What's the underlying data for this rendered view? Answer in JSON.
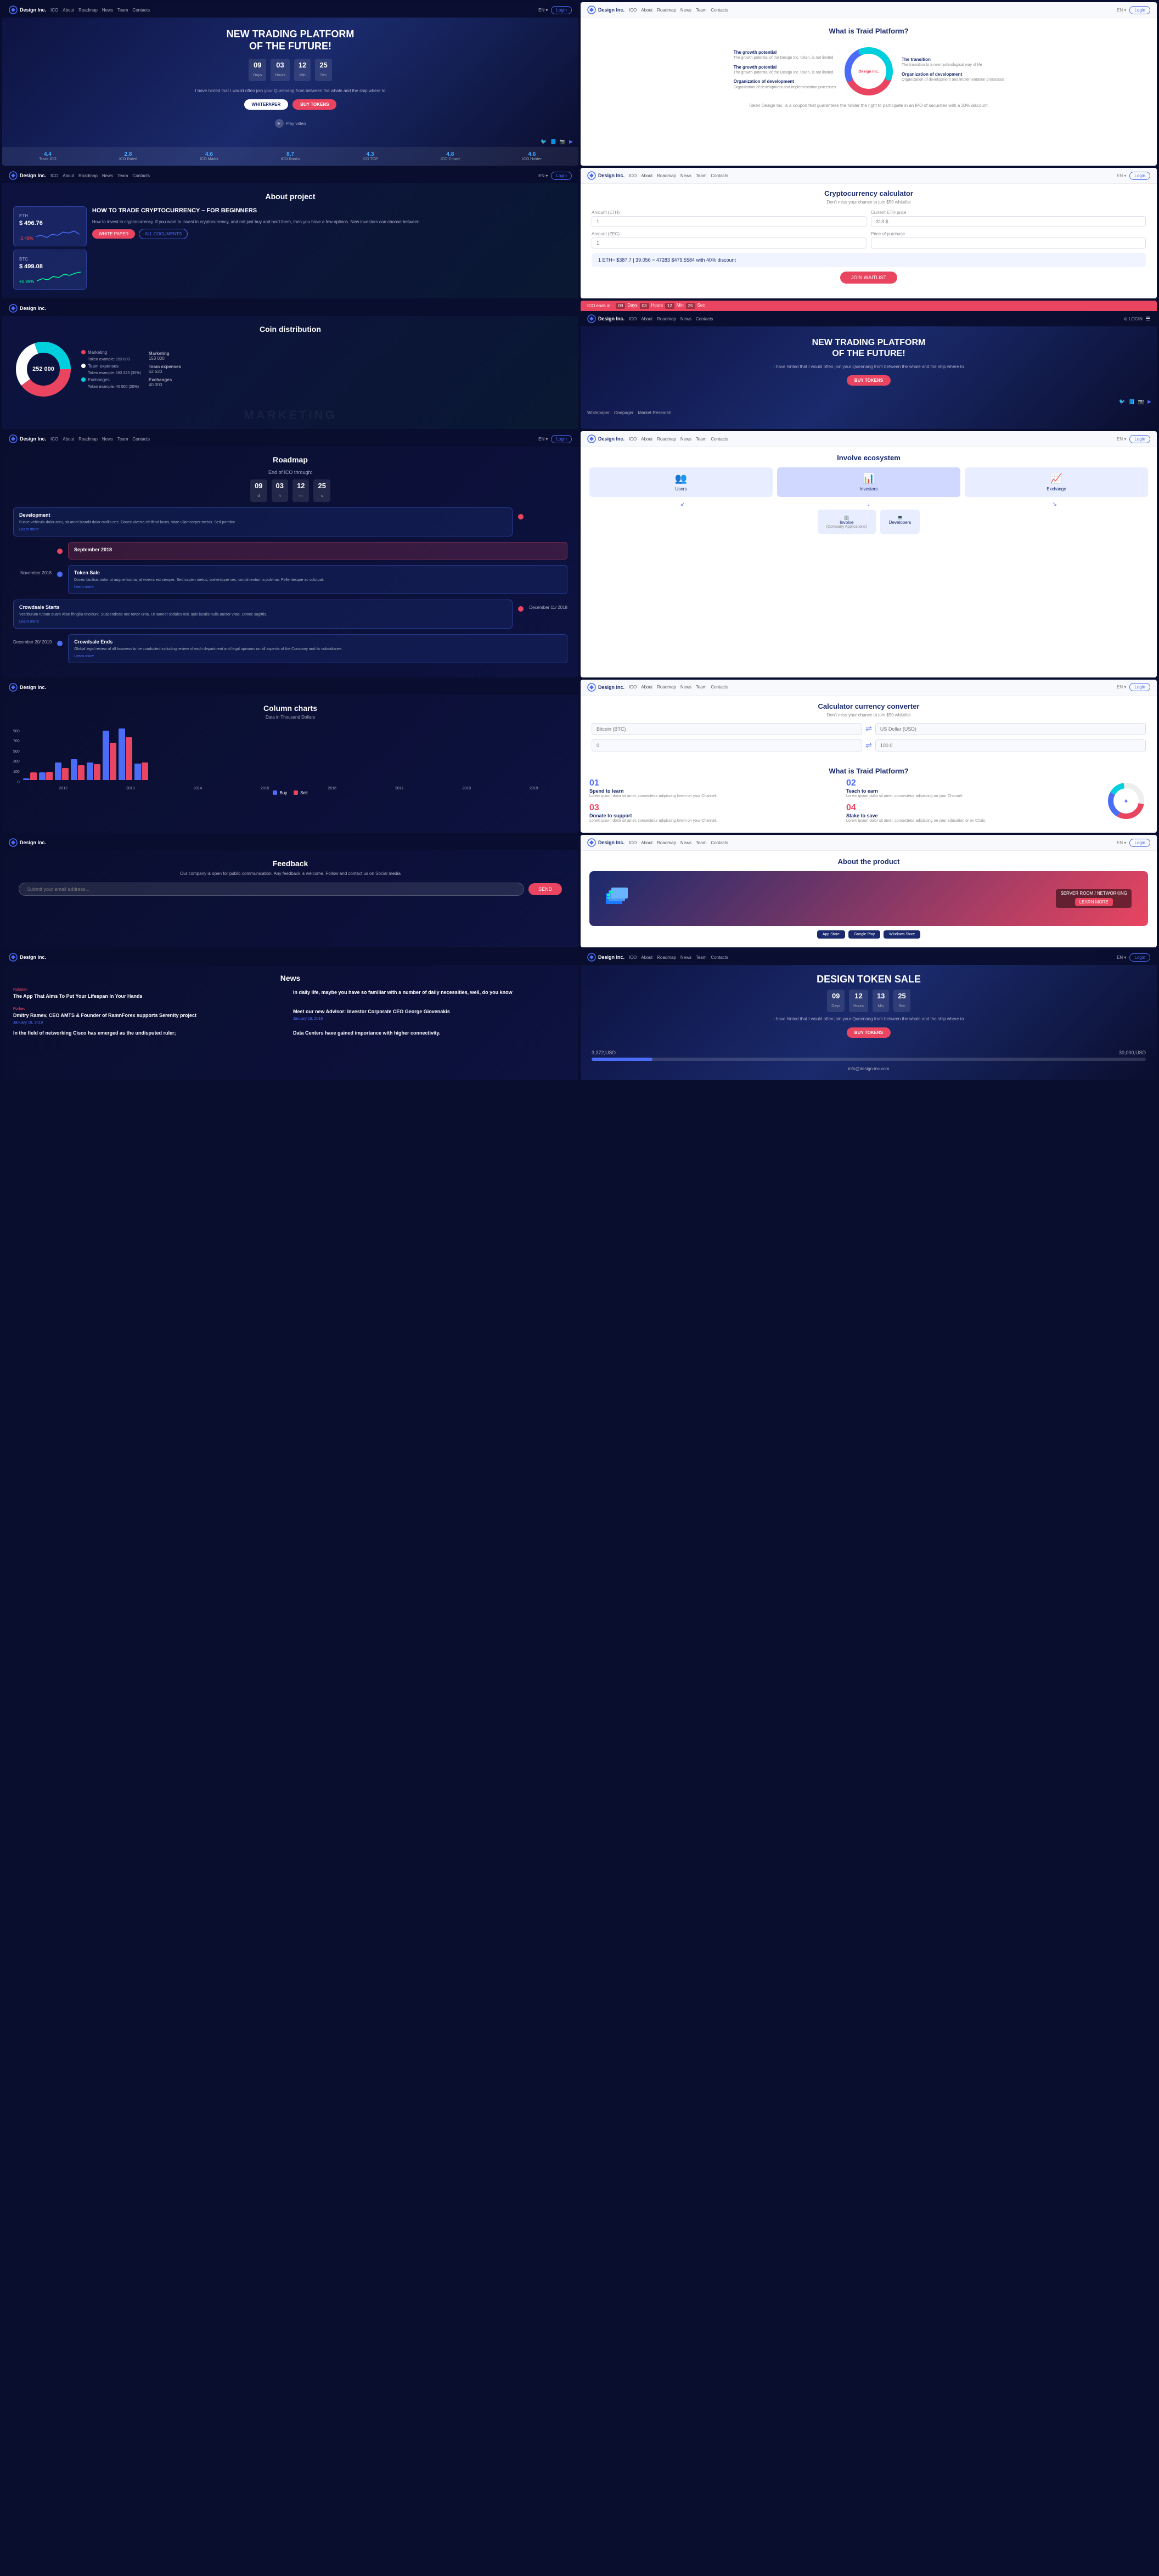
{
  "nav": {
    "logo": "Design Inc.",
    "links": [
      "ICO",
      "About",
      "Roadmap",
      "News",
      "Team",
      "Contacts"
    ],
    "lang": "EN",
    "login": "Login"
  },
  "panel1": {
    "title": "NEW TRADING PLATFORM\nOF THE FUTURE!",
    "countdown": [
      {
        "num": "09",
        "label": "Days"
      },
      {
        "num": "03",
        "label": "Hours"
      },
      {
        "num": "12",
        "label": "Min"
      },
      {
        "num": "25",
        "label": "Sec"
      }
    ],
    "tagline": "I have hinted that I would often join your Queenang from between the whale and the ship where to",
    "btn1": "WHITEPAPER",
    "btn2": "BUY TOKENS",
    "play_label": "Play video",
    "stats": [
      {
        "val": "4.4",
        "label": "Track ICO"
      },
      {
        "val": "2.8",
        "label": "ICO Rated"
      },
      {
        "val": "4.6",
        "label": "ICO Marks"
      },
      {
        "val": "8.7",
        "label": "ICO Ranks"
      },
      {
        "val": "4.3",
        "label": "ICO TOP"
      },
      {
        "val": "4.8",
        "label": "ICO Crowd"
      },
      {
        "val": "4.6",
        "label": "ICO Holder"
      }
    ]
  },
  "panel2": {
    "title": "What is Traid Platform?",
    "description": "Token Design Inc. is a coupon that guarantees the holder the right to participate in an IPO of securities with a 30% discount.",
    "center": "Design Inc.",
    "labels": [
      "The growth potential of the Design Inc. token, is not limited",
      "The growth potential of the Design Inc. token, is not limited",
      "Organization of development and implementation processes",
      "The transition to a new technological way of life",
      "Organization of development and implementation processes"
    ]
  },
  "panel3": {
    "title": "About project",
    "crypto1": {
      "symbol": "ETH",
      "price": "$ 496.76",
      "change": "-2.49%"
    },
    "crypto2": {
      "symbol": "BTC",
      "price": "$ 499.08",
      "change": "+0.89%"
    },
    "section_title": "HOW TO TRADE CRYPTOCURRENCY – FOR BEGINNERS",
    "description": "How to invest in cryptocurrency. If you want to invest in cryptocurrency, and not just buy and hold them, then you have a few options. New investors can choose between",
    "btn1": "WHITE PAPER",
    "btn2": "ALL DOCUMENTS"
  },
  "panel4": {
    "title": "Cryptocurrency calculator",
    "subtitle": "Don't miss your chance to join $50 whitelist",
    "fields": [
      {
        "label": "Amount (ETH)",
        "placeholder": "1"
      },
      {
        "label": "Current ETH price",
        "placeholder": "313 $"
      }
    ],
    "fields2": [
      {
        "label": "Amount (ZEC)",
        "placeholder": "1"
      },
      {
        "label": "Price of purchase",
        "placeholder": ""
      }
    ],
    "result": "1 ETH= $387.7 | 39.056 = 47283     $479.5584 with 40% discount",
    "btn": "JOIN WAITLIST"
  },
  "panel5": {
    "title": "Coin distribution",
    "center_label": "252 000",
    "segments": [
      {
        "label": "Marketing",
        "value": "153 000",
        "color": "#e94560",
        "pct": 40
      },
      {
        "label": "Team expenses",
        "value": "",
        "color": "#fff",
        "pct": 30
      },
      {
        "label": "Exchanges",
        "value": "40 000",
        "color": "#00cfde",
        "pct": 30
      }
    ]
  },
  "panel6": {
    "title": "NEW TRADING PLATFORM\nOF THE FUTURE!",
    "tagline": "I have hinted that I would often join your Queenang from between the whale and the ship where to",
    "btn": "BUY TOKENS",
    "countdown": [
      {
        "num": "09",
        "label": "Days"
      },
      {
        "num": "03",
        "label": "Hours"
      },
      {
        "num": "12",
        "label": "Min"
      },
      {
        "num": "25",
        "label": "Sec"
      }
    ]
  },
  "panel7": {
    "title": "Roadmap",
    "countdown_label": "End of ICO through:",
    "countdown": [
      {
        "num": "09",
        "label": ""
      },
      {
        "num": "03",
        "label": ""
      },
      {
        "num": "12",
        "label": ""
      },
      {
        "num": "25",
        "label": ""
      }
    ],
    "events": [
      {
        "title": "Development",
        "desc": "Fusce vehicula dolor arcu, sit amet blandit dolor mollis nec. Donec viverra eleifend lacus, vitae ullamcorper metus. Sed porttitor.",
        "date": "",
        "learn": "Learn more",
        "side": "left"
      },
      {
        "title": "September 2018",
        "desc": "",
        "date": "September 2018",
        "learn": "",
        "side": "right"
      },
      {
        "title": "Token Sale",
        "desc": "Donec facilisis tortor ut augue lacinia, at viverra est semper. Sed sapien metus, scelerisque nec, condimentum a pulvinar. Pellentesque ac volutpat.",
        "date": "November 2018",
        "learn": "Learn more",
        "side": "right"
      },
      {
        "title": "Crowdsale Starts",
        "desc": "Vestibulum rutrum quam vitae fringilla tincidunt. Suspendisse nec tortor urna. Ut laoreet sodales nisi, quis iaculis nulla auctor vitae. Donec sagittis.",
        "date": "December 11/ 2018",
        "learn": "Learn more",
        "side": "left"
      },
      {
        "title": "Crowdsale Ends",
        "desc": "Global legal review of all business to be conducted including review of each department and legal opinions on all aspects of the Company and its subsidiaries.",
        "date": "December 20/ 2019",
        "learn": "Learn more",
        "side": "right"
      }
    ]
  },
  "panel8": {
    "title": "Involve ecosystem",
    "nodes": [
      {
        "label": "Users",
        "icon": "👥"
      },
      {
        "label": "Investors",
        "icon": "📊"
      },
      {
        "label": "Exchange",
        "icon": "📈"
      },
      {
        "label": "Involve\n(Company Applications)",
        "icon": "🏢"
      },
      {
        "label": "Developers",
        "icon": "💻"
      }
    ]
  },
  "panel9": {
    "title": "Column charts",
    "subtitle": "Data in Thousand Dollars",
    "legend": [
      "Buy",
      "Sell"
    ],
    "data": [
      {
        "label": "2012",
        "buy": 25,
        "sell": 125
      },
      {
        "label": "2013",
        "buy": 125,
        "sell": 135
      },
      {
        "label": "2014",
        "buy": 290,
        "sell": 200
      },
      {
        "label": "2015",
        "buy": 340,
        "sell": 240
      },
      {
        "label": "2016",
        "buy": 290,
        "sell": 260
      },
      {
        "label": "2017",
        "buy": 810,
        "sell": 610
      },
      {
        "label": "2018",
        "buy": 850,
        "sell": 700
      },
      {
        "label": "2019",
        "buy": 270,
        "sell": 290
      }
    ]
  },
  "panel10": {
    "title": "Calculator currency converter",
    "subtitle": "Don't miss your chance to join $50 whitelist",
    "from_label": "Bitcoin (BTC)",
    "from_val": "0",
    "to_label": "US Dollar (USD)",
    "to_val": "100.0"
  },
  "panel11": {
    "title": "Feedback",
    "subtitle": "Our company is open for public communication. Any feedback is welcome. Follow and contact us on Social media",
    "placeholder": "Submit your email address...",
    "btn": "SEND"
  },
  "panel12": {
    "title": "What is Traid Platform?",
    "features": [
      {
        "num": "01",
        "name": "Spend to learn",
        "desc": "Lorem ipsum dolor sit amet, consectetur adipiscing lorem on your Channel."
      },
      {
        "num": "02",
        "name": "Teach to earn",
        "desc": "Lorem ipsum dolor sit amet, consectetur adipiscing on your Channel."
      },
      {
        "num": "03",
        "name": "Donate to support",
        "desc": "Lorem ipsum dolor sit amet, consectetur adipiscing lorem on your Channel."
      },
      {
        "num": "04",
        "name": "Stake to save",
        "desc": "Lorem ipsum dolor sit amet, consectetur adipiscing on your education or on Chain."
      }
    ]
  },
  "panel13": {
    "title": "News",
    "items": [
      {
        "source": "Rakuten",
        "title": "The App That Aims To Put Your Lifespan In Your Hands",
        "desc": "",
        "date": ""
      },
      {
        "source": "",
        "title": "In daily life, maybe you have so familiar with a number of daily necessities, well, do you know",
        "desc": "",
        "date": ""
      },
      {
        "source": "Forbes",
        "title": "Dmitry Ramev, CEO AMTS & Founder of RamnForex supports Serenity project",
        "desc": "",
        "date": "January 18, 2019"
      },
      {
        "source": "",
        "title": "Meet our new Advisor: Investor Corporate CEO George Giovenakis",
        "desc": "",
        "date": "January 19, 2019"
      },
      {
        "source": "",
        "title": "In the field of networking Cisco has emerged as the undisputed ruler;",
        "desc": "",
        "date": ""
      },
      {
        "source": "",
        "title": "Data Centers have gained importance with higher connectivity.",
        "desc": "",
        "date": ""
      }
    ]
  },
  "panel14": {
    "title": "About the product",
    "server_label": "SERVER ROOM / NETWORKING",
    "learn_more": "LEARN MORE",
    "app_btns": [
      "App Store",
      "Google Play",
      "Windows Store"
    ]
  },
  "panel15": {
    "title": "DESIGN TOKEN SALE",
    "countdown": [
      {
        "num": "09",
        "label": "Days"
      },
      {
        "num": "12",
        "label": "Hours"
      },
      {
        "num": "13",
        "label": "Min"
      },
      {
        "num": "25",
        "label": "Sec"
      }
    ],
    "tagline": "I have hinted that I would often join your Queenang from between the whale and the ship where to",
    "btn": "BUY TOKENS",
    "raised": "3,372,USD",
    "goal": "30,000,USD",
    "progress": 11,
    "email": "info@design-inc.com"
  }
}
